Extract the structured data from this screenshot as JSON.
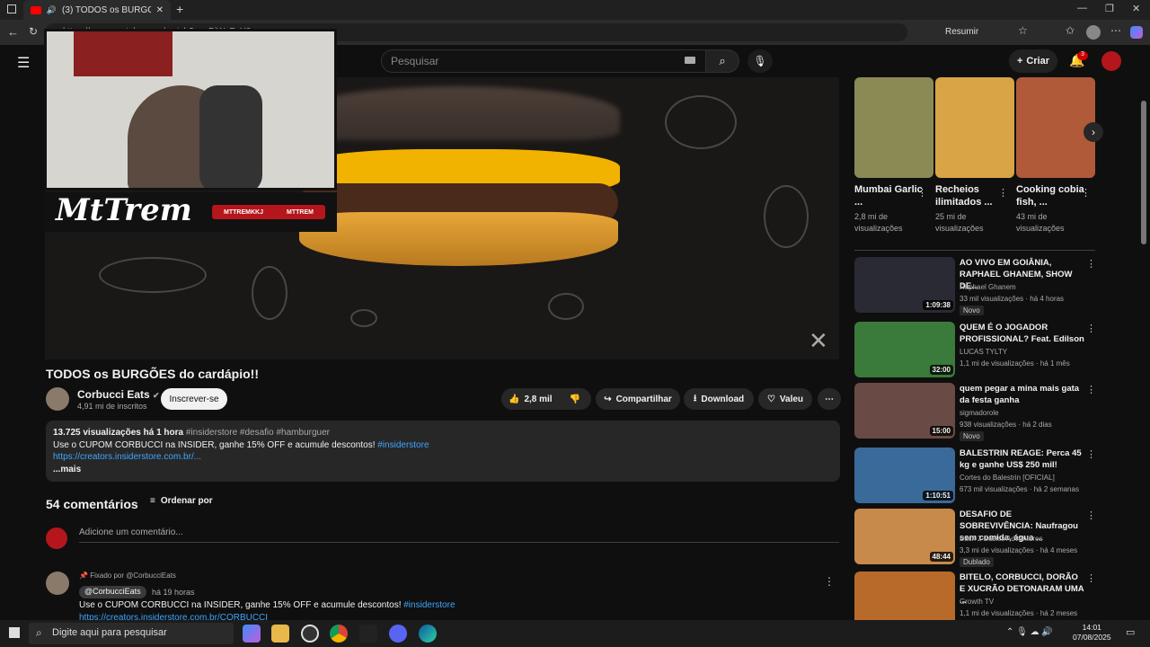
{
  "browser": {
    "tab_title": "(3) TODOS os BURGÕES do c...",
    "url": "https://www.youtube.com/watch?v=nBiWcFaY0as",
    "summarize": "Resumir"
  },
  "header": {
    "search_placeholder": "Pesquisar",
    "create_label": "Criar",
    "notif_count": "3"
  },
  "overlay": {
    "brand": "MtTrem",
    "social1": "MTTREMKKJ",
    "social2": "MTTREM"
  },
  "video": {
    "title": "TODOS os BURGÕES do cardápio!!",
    "channel": "Corbucci Eats",
    "subscribers": "4,91 mi de inscritos",
    "subscribe_label": "Inscrever-se",
    "likes": "2,8 mil",
    "share_label": "Compartilhar",
    "download_label": "Download",
    "thanks_label": "Valeu"
  },
  "description": {
    "stats": "13.725 visualizações  há 1 hora",
    "tags": "#insiderstore #desafio #hamburguer",
    "line1": "Use o CUPOM CORBUCCI na INSIDER, ganhe 15% OFF e acumule descontos!",
    "line1_tag": "#insiderstore",
    "link": "https://creators.insiderstore.com.br/...",
    "more": "...mais"
  },
  "comments": {
    "count_label": "54 comentários",
    "sort_label": "Ordenar por",
    "add_placeholder": "Adicione um comentário...",
    "pinned_by": "Fixado por @CorbucciEats",
    "handle": "@CorbucciEats",
    "time": "há 19 horas",
    "text": "Use o CUPOM CORBUCCI na INSIDER, ganhe 15% OFF e acumule descontos!",
    "text_tag": "#insiderstore",
    "link": "https://creators.insiderstore.com.br/CORBUCCI"
  },
  "shorts": [
    {
      "title": "Mumbai Garlic ...",
      "views": "2,8 mi de visualizações",
      "color": "#8a8a55"
    },
    {
      "title": "Recheios ilimitados ...",
      "views": "25 mi de visualizações",
      "color": "#d9a445"
    },
    {
      "title": "Cooking cobia fish, ...",
      "views": "43 mi de visualizações",
      "color": "#b05a3a"
    }
  ],
  "related": [
    {
      "title": "AO VIVO EM GOIÂNIA, RAPHAEL GHANEM, SHOW DE...",
      "channel": "Raphael Ghanem",
      "views": "33 mil visualizações · há 4 horas",
      "badge": "Novo",
      "duration": "1:09:38",
      "color": "#2a2a35"
    },
    {
      "title": "QUEM É O JOGADOR PROFISSIONAL? Feat. Edilson",
      "channel": "LUCAS TYLTY",
      "views": "1,1 mi de visualizações · há 1 mês",
      "badge": "",
      "duration": "32:00",
      "color": "#3a7a3a"
    },
    {
      "title": "quem pegar a mina mais gata da festa ganha",
      "channel": "sigmadorole",
      "views": "938 visualizações · há 2 dias",
      "badge": "Novo",
      "duration": "15:00",
      "color": "#6a4a45"
    },
    {
      "title": "BALESTRIN REAGE: Perca 45 kg e ganhe US$ 250 mil!",
      "channel": "Cortes do Balestrin [OFICIAL]",
      "views": "673 mil visualizações · há 2 semanas",
      "badge": "",
      "duration": "1:10:51",
      "color": "#3a6a9a"
    },
    {
      "title": "DESAFIO DE SOBREVIVÊNCIA: Naufragou sem comida, água ...",
      "channel": "Back 2 Basics Adventures",
      "views": "3,3 mi de visualizações · há 4 meses",
      "badge": "Dublado",
      "duration": "48:44",
      "color": "#c88a4a"
    },
    {
      "title": "BITELO, CORBUCCI, DORÃO E XUCRÃO DETONARAM UMA ...",
      "channel": "Growth TV",
      "views": "1,1 mi de visualizações · há 2 meses",
      "badge": "",
      "duration": "",
      "color": "#b86a2a"
    }
  ],
  "taskbar": {
    "search": "Digite aqui para pesquisar",
    "time": "14:01",
    "date": "07/08/2025"
  }
}
